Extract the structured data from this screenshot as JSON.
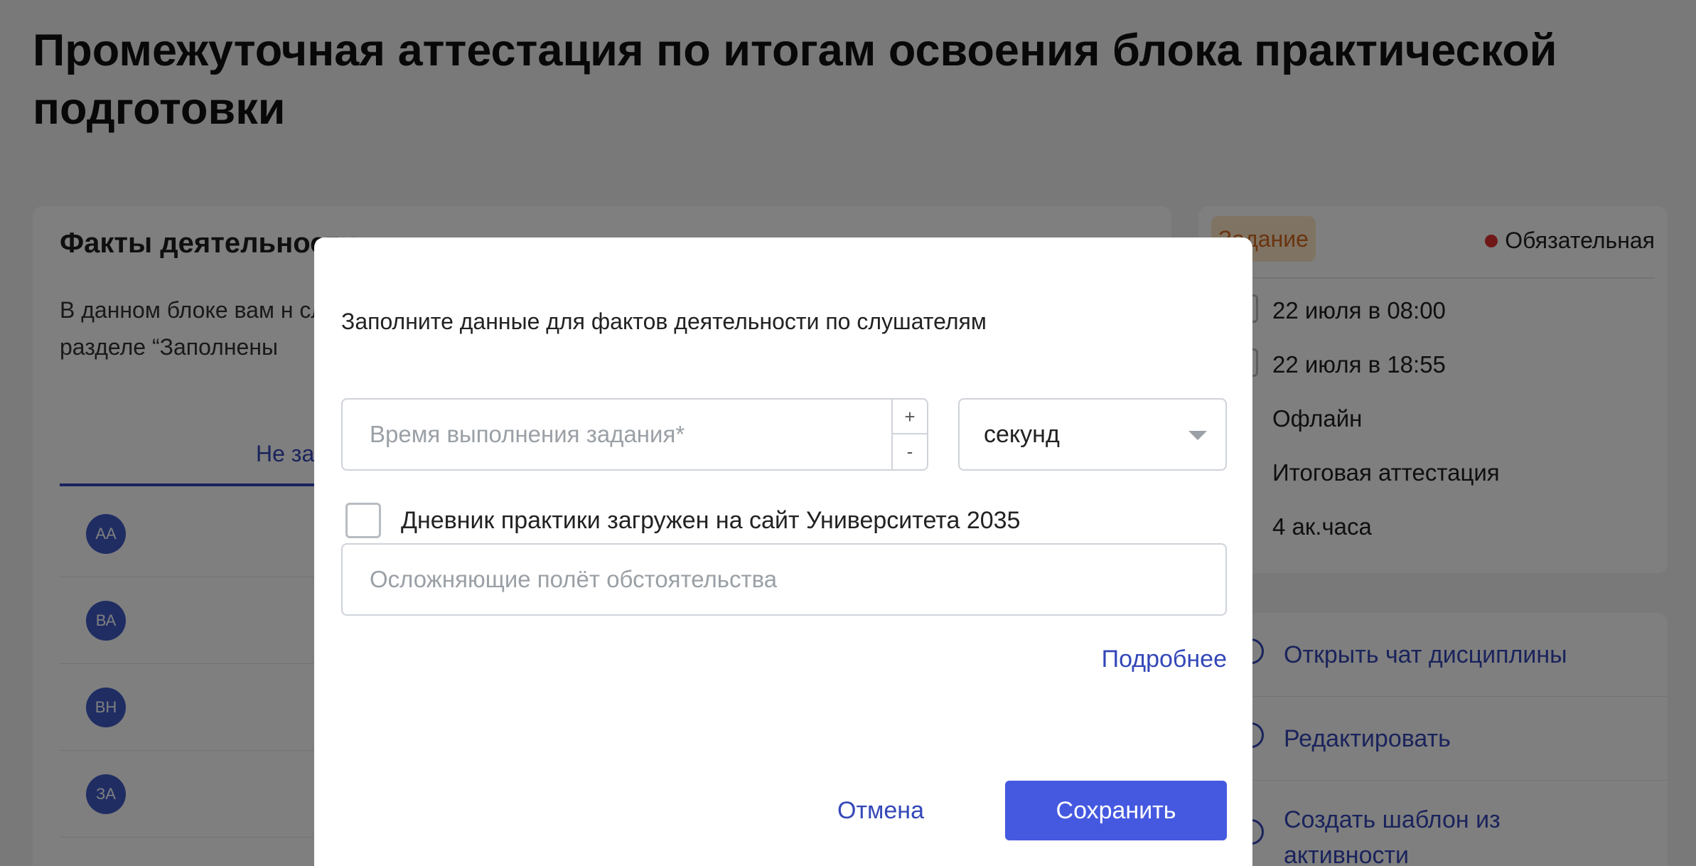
{
  "page": {
    "title": "Промежуточная аттестация по итогам освоения блока практической подготовки"
  },
  "facts_card": {
    "title": "Факты деятельности",
    "description": "В данном блоке вам н следа по слушателям в разделе “Заполнены",
    "tab_label": "Не за",
    "students": [
      {
        "initials": "АА"
      },
      {
        "initials": "ВА"
      },
      {
        "initials": "ВН"
      },
      {
        "initials": "ЗА"
      }
    ]
  },
  "info_card": {
    "type_badge": "Задание",
    "required_label": "Обязательная",
    "start": "22 июля в 08:00",
    "end": "22 июля в 18:55",
    "format": "Офлайн",
    "kind": "Итоговая аттестация",
    "hours": "4 ак.часа"
  },
  "actions": [
    {
      "label": "Открыть чат дисциплины",
      "icon": "chat-icon"
    },
    {
      "label": "Редактировать",
      "icon": "edit-icon"
    },
    {
      "label": "Создать шаблон из активности",
      "icon": "template-icon"
    }
  ],
  "modal": {
    "heading": "Заполните данные для фактов деятельности по слушателям",
    "time_field": {
      "placeholder": "Время выполнения задания*",
      "value": "",
      "increment": "+",
      "decrement": "-"
    },
    "unit_select": {
      "value": "секунд"
    },
    "diary_checkbox": {
      "label": "Дневник практики загружен на сайт Университета 2035",
      "checked": false
    },
    "complications_field": {
      "placeholder": "Осложняющие полёт обстоятельства",
      "value": ""
    },
    "more_link": "Подробнее",
    "cancel_label": "Отмена",
    "save_label": "Сохранить"
  },
  "colors": {
    "accent": "#4559e0",
    "link": "#3447b8",
    "required_dot": "#e03030",
    "badge_bg": "#ffe6c7",
    "badge_text": "#d2691e"
  }
}
